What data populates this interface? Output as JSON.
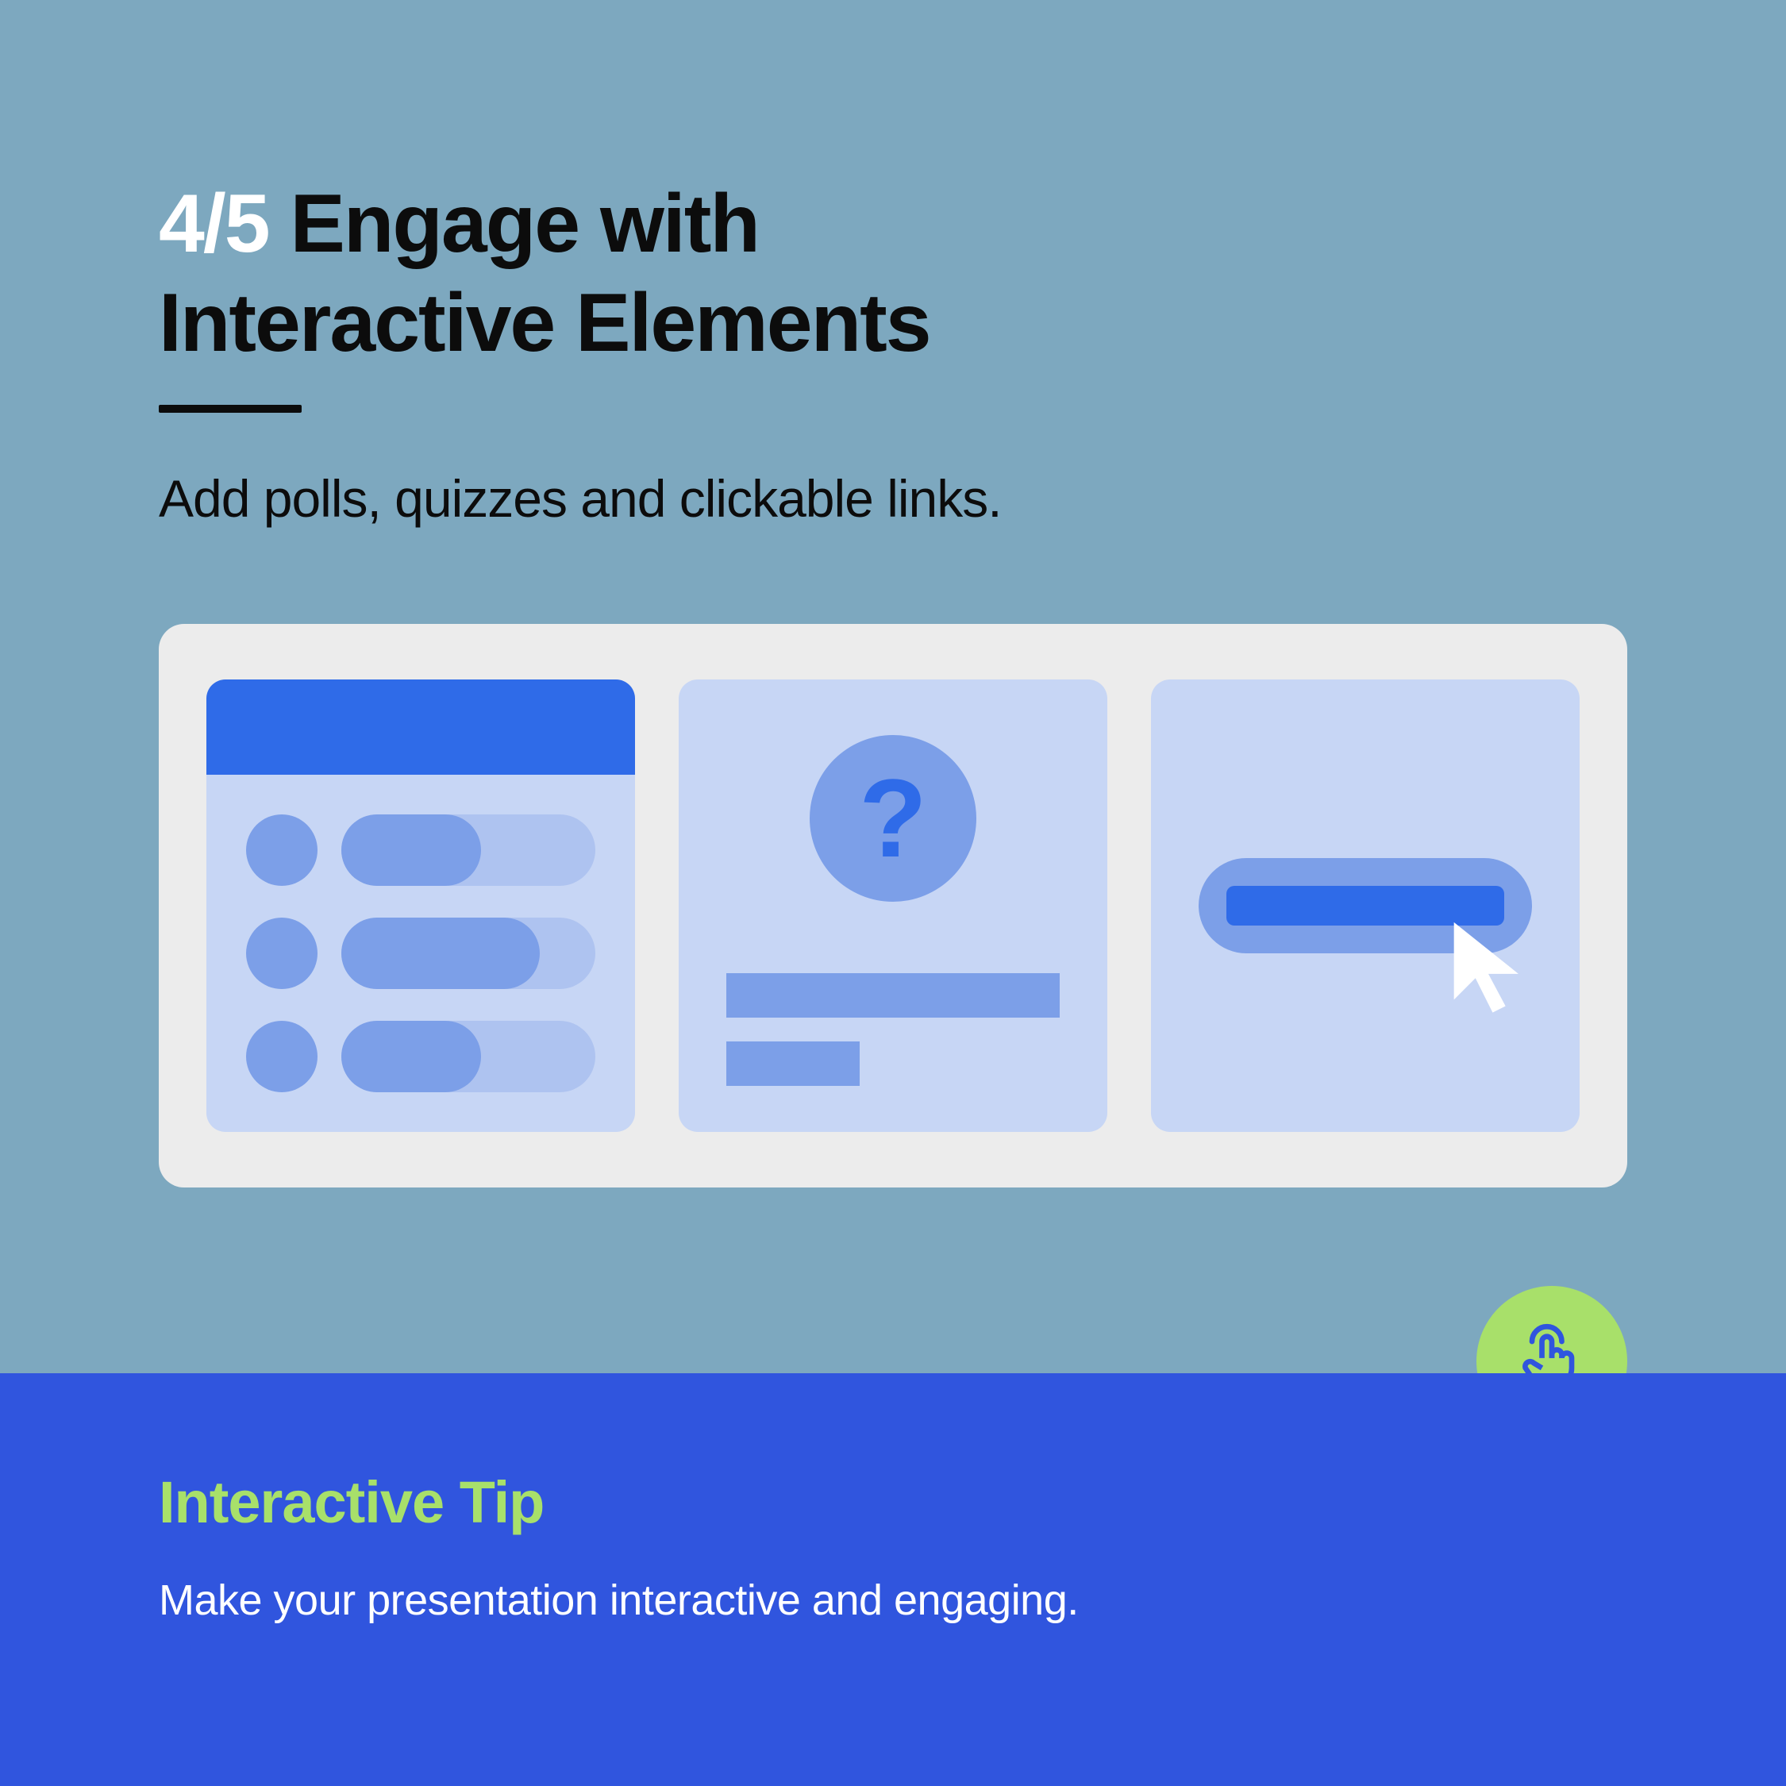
{
  "heading": {
    "step": "4/5",
    "title_line1": "Engage with",
    "title_line2": "Interactive Elements"
  },
  "subtitle": "Add polls, quizzes and clickable links.",
  "cards": {
    "poll": {
      "name": "poll",
      "fills": [
        55,
        78,
        55
      ]
    },
    "quiz": {
      "name": "quiz",
      "symbol": "?"
    },
    "link": {
      "name": "clickable-link"
    }
  },
  "tip": {
    "title": "Interactive Tip",
    "body": "Make your presentation interactive and engaging."
  },
  "colors": {
    "bg_top": "#7DA8BF",
    "bg_bottom": "#3055DE",
    "accent": "#A8E06A",
    "card_bg": "#C7D6F5",
    "primary": "#2F6BE8",
    "secondary": "#7C9FE8"
  }
}
